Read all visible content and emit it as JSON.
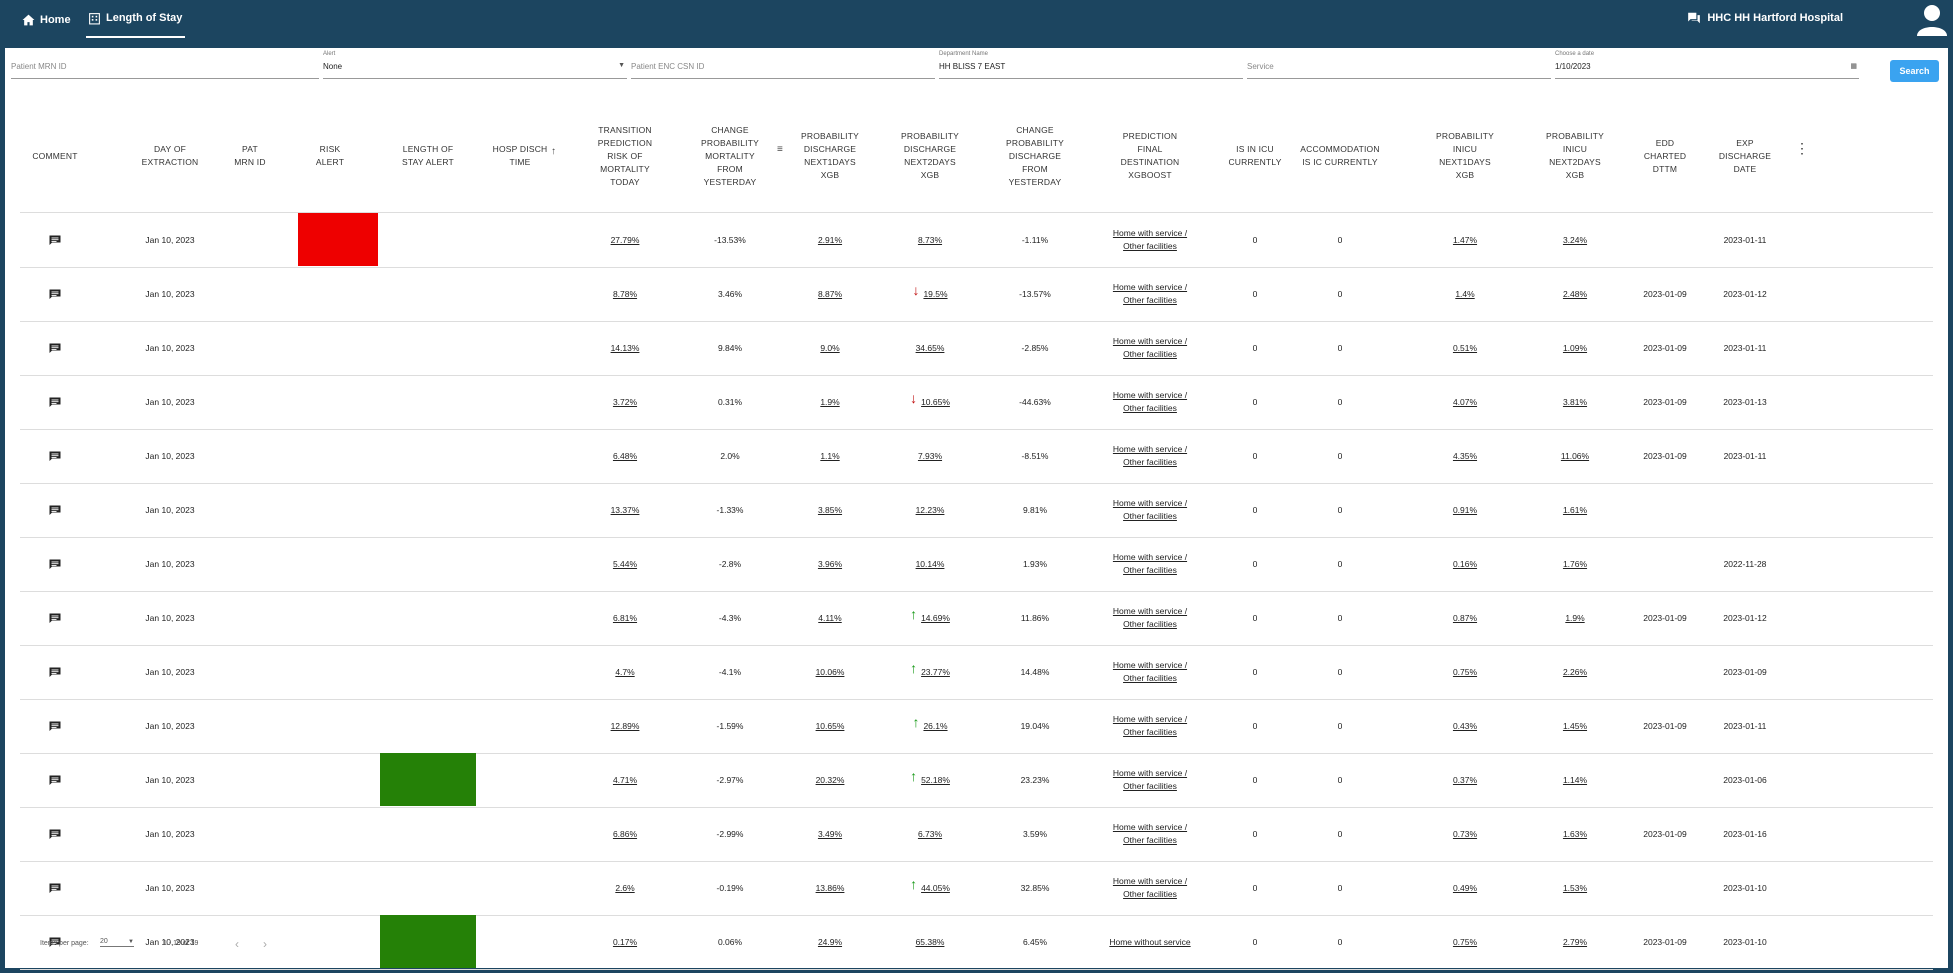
{
  "nav": {
    "home_label": "Home",
    "los_label": "Length of Stay",
    "hospital_label": "HHC HH Hartford Hospital"
  },
  "filters": {
    "mrn_placeholder": "Patient MRN ID",
    "alert_label": "Alert",
    "alert_value": "None",
    "csn_placeholder": "Patient ENC CSN ID",
    "department_label": "Department Name",
    "department_value": "HH BLISS 7 EAST",
    "service_placeholder": "Service",
    "date_label": "Choose a date",
    "date_value": "1/10/2023",
    "search_label": "Search"
  },
  "columns": [
    [
      "COMMENT"
    ],
    [
      "DAY OF",
      "EXTRACTION"
    ],
    [
      "PAT",
      "MRN ID"
    ],
    [
      "RISK",
      "ALERT"
    ],
    [
      "LENGTH OF",
      "STAY ALERT"
    ],
    [
      "HOSP DISCH",
      "TIME"
    ],
    [
      "TRANSITION",
      "PREDICTION",
      "RISK OF",
      "MORTALITY",
      "TODAY"
    ],
    [
      "CHANGE",
      "PROBABILITY",
      "MORTALITY",
      "FROM",
      "YESTERDAY"
    ],
    [
      "PROBABILITY",
      "DISCHARGE",
      "NEXT1DAYS",
      "XGB"
    ],
    [
      "PROBABILITY",
      "DISCHARGE",
      "NEXT2DAYS",
      "XGB"
    ],
    [
      "CHANGE",
      "PROBABILITY",
      "DISCHARGE",
      "FROM",
      "YESTERDAY"
    ],
    [
      "PREDICTION",
      "FINAL",
      "DESTINATION",
      "XGBOOST"
    ],
    [
      "IS IN ICU",
      "CURRENTLY"
    ],
    [
      "ACCOMMODATION",
      "IS IC CURRENTLY"
    ],
    [
      "PROBABILITY",
      "INICU",
      "NEXT1DAYS",
      "XGB"
    ],
    [
      "PROBABILITY",
      "INICU",
      "NEXT2DAYS",
      "XGB"
    ],
    [
      "EDD",
      "CHARTED",
      "DTTM"
    ],
    [
      "EXP",
      "DISCHARGE",
      "DATE"
    ]
  ],
  "colors": {
    "risk_red": "#ee0000",
    "los_green": "#258107",
    "trend_up": "#1a9b1a",
    "trend_down": "#c01010",
    "accent": "#3aa3f0",
    "navbar": "#1c4560"
  },
  "rows": [
    {
      "day": "Jan 10, 2023",
      "risk": "red",
      "los": "",
      "mort": "27.79%",
      "chg_mort": "-13.53%",
      "d1": "2.91%",
      "d2": "8.73%",
      "trend": "",
      "chg_d": "-1.11%",
      "dest1": "Home with service /",
      "dest2": "Other facilities",
      "icu": "0",
      "acc": "0",
      "i1": "1.47%",
      "i2": "3.24%",
      "edd": "",
      "exp": "2023-01-11"
    },
    {
      "day": "Jan 10, 2023",
      "risk": "",
      "los": "",
      "mort": "8.78%",
      "chg_mort": "3.46%",
      "d1": "8.87%",
      "d2": "19.5%",
      "trend": "down",
      "chg_d": "-13.57%",
      "dest1": "Home with service /",
      "dest2": "Other facilities",
      "icu": "0",
      "acc": "0",
      "i1": "1.4%",
      "i2": "2.48%",
      "edd": "2023-01-09",
      "exp": "2023-01-12"
    },
    {
      "day": "Jan 10, 2023",
      "risk": "",
      "los": "",
      "mort": "14.13%",
      "chg_mort": "9.84%",
      "d1": "9.0%",
      "d2": "34.65%",
      "trend": "",
      "chg_d": "-2.85%",
      "dest1": "Home with service /",
      "dest2": "Other facilities",
      "icu": "0",
      "acc": "0",
      "i1": "0.51%",
      "i2": "1.09%",
      "edd": "2023-01-09",
      "exp": "2023-01-11"
    },
    {
      "day": "Jan 10, 2023",
      "risk": "",
      "los": "",
      "mort": "3.72%",
      "chg_mort": "0.31%",
      "d1": "1.9%",
      "d2": "10.65%",
      "trend": "down",
      "chg_d": "-44.63%",
      "dest1": "Home with service /",
      "dest2": "Other facilities",
      "icu": "0",
      "acc": "0",
      "i1": "4.07%",
      "i2": "3.81%",
      "edd": "2023-01-09",
      "exp": "2023-01-13"
    },
    {
      "day": "Jan 10, 2023",
      "risk": "",
      "los": "",
      "mort": "6.48%",
      "chg_mort": "2.0%",
      "d1": "1.1%",
      "d2": "7.93%",
      "trend": "",
      "chg_d": "-8.51%",
      "dest1": "Home with service /",
      "dest2": "Other facilities",
      "icu": "0",
      "acc": "0",
      "i1": "4.35%",
      "i2": "11.06%",
      "edd": "2023-01-09",
      "exp": "2023-01-11"
    },
    {
      "day": "Jan 10, 2023",
      "risk": "",
      "los": "",
      "mort": "13.37%",
      "chg_mort": "-1.33%",
      "d1": "3.85%",
      "d2": "12.23%",
      "trend": "",
      "chg_d": "9.81%",
      "dest1": "Home with service /",
      "dest2": "Other facilities",
      "icu": "0",
      "acc": "0",
      "i1": "0.91%",
      "i2": "1.61%",
      "edd": "",
      "exp": ""
    },
    {
      "day": "Jan 10, 2023",
      "risk": "",
      "los": "",
      "mort": "5.44%",
      "chg_mort": "-2.8%",
      "d1": "3.96%",
      "d2": "10.14%",
      "trend": "",
      "chg_d": "1.93%",
      "dest1": "Home with service /",
      "dest2": "Other facilities",
      "icu": "0",
      "acc": "0",
      "i1": "0.16%",
      "i2": "1.76%",
      "edd": "",
      "exp": "2022-11-28"
    },
    {
      "day": "Jan 10, 2023",
      "risk": "",
      "los": "",
      "mort": "6.81%",
      "chg_mort": "-4.3%",
      "d1": "4.11%",
      "d2": "14.69%",
      "trend": "up",
      "chg_d": "11.86%",
      "dest1": "Home with service /",
      "dest2": "Other facilities",
      "icu": "0",
      "acc": "0",
      "i1": "0.87%",
      "i2": "1.9%",
      "edd": "2023-01-09",
      "exp": "2023-01-12"
    },
    {
      "day": "Jan 10, 2023",
      "risk": "",
      "los": "",
      "mort": "4.7%",
      "chg_mort": "-4.1%",
      "d1": "10.06%",
      "d2": "23.77%",
      "trend": "up",
      "chg_d": "14.48%",
      "dest1": "Home with service /",
      "dest2": "Other facilities",
      "icu": "0",
      "acc": "0",
      "i1": "0.75%",
      "i2": "2.26%",
      "edd": "",
      "exp": "2023-01-09"
    },
    {
      "day": "Jan 10, 2023",
      "risk": "",
      "los": "",
      "mort": "12.89%",
      "chg_mort": "-1.59%",
      "d1": "10.65%",
      "d2": "26.1%",
      "trend": "up",
      "chg_d": "19.04%",
      "dest1": "Home with service /",
      "dest2": "Other facilities",
      "icu": "0",
      "acc": "0",
      "i1": "0.43%",
      "i2": "1.45%",
      "edd": "2023-01-09",
      "exp": "2023-01-11"
    },
    {
      "day": "Jan 10, 2023",
      "risk": "",
      "los": "green",
      "mort": "4.71%",
      "chg_mort": "-2.97%",
      "d1": "20.32%",
      "d2": "52.18%",
      "trend": "up",
      "chg_d": "23.23%",
      "dest1": "Home with service /",
      "dest2": "Other facilities",
      "icu": "0",
      "acc": "0",
      "i1": "0.37%",
      "i2": "1.14%",
      "edd": "",
      "exp": "2023-01-06"
    },
    {
      "day": "Jan 10, 2023",
      "risk": "",
      "los": "",
      "mort": "6.86%",
      "chg_mort": "-2.99%",
      "d1": "3.49%",
      "d2": "6.73%",
      "trend": "",
      "chg_d": "3.59%",
      "dest1": "Home with service /",
      "dest2": "Other facilities",
      "icu": "0",
      "acc": "0",
      "i1": "0.73%",
      "i2": "1.63%",
      "edd": "2023-01-09",
      "exp": "2023-01-16"
    },
    {
      "day": "Jan 10, 2023",
      "risk": "",
      "los": "",
      "mort": "2.6%",
      "chg_mort": "-0.19%",
      "d1": "13.86%",
      "d2": "44.05%",
      "trend": "up",
      "chg_d": "32.85%",
      "dest1": "Home with service /",
      "dest2": "Other facilities",
      "icu": "0",
      "acc": "0",
      "i1": "0.49%",
      "i2": "1.53%",
      "edd": "",
      "exp": "2023-01-10"
    },
    {
      "day": "Jan 10, 2023",
      "risk": "",
      "los": "green",
      "mort": "0.17%",
      "chg_mort": "0.06%",
      "d1": "24.9%",
      "d2": "65.38%",
      "trend": "",
      "chg_d": "6.45%",
      "dest1": "Home without service",
      "dest2": "",
      "icu": "0",
      "acc": "0",
      "i1": "0.75%",
      "i2": "2.79%",
      "edd": "2023-01-09",
      "exp": "2023-01-10"
    }
  ],
  "paginator": {
    "items_label": "Items per page:",
    "page_size": "20",
    "range": "1 - 19 of 19"
  }
}
